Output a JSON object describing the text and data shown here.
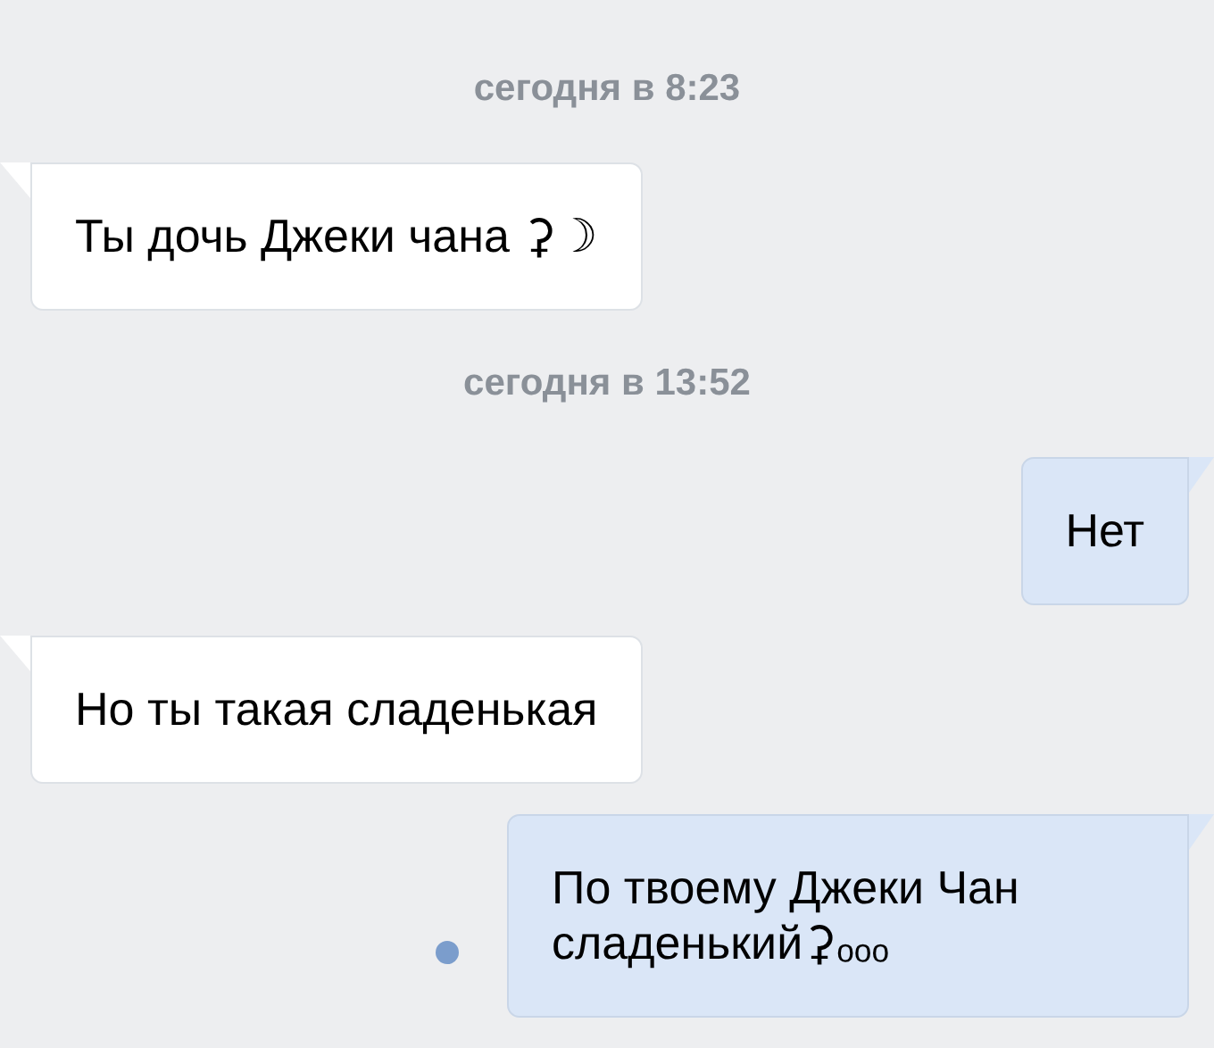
{
  "messages": [
    {
      "kind": "date",
      "text": "сегодня в 8:23"
    },
    {
      "kind": "incoming",
      "text": "Ты дочь Джеки чана ⚳☽"
    },
    {
      "kind": "date",
      "text": "сегодня в 13:52"
    },
    {
      "kind": "outgoing",
      "text": "Нет",
      "unread": false
    },
    {
      "kind": "incoming",
      "text": "Но ты такая сладенькая"
    },
    {
      "kind": "outgoing",
      "text": "По твоему Джеки Чан сладенький⚳ₒₒₒ",
      "unread": true
    }
  ]
}
